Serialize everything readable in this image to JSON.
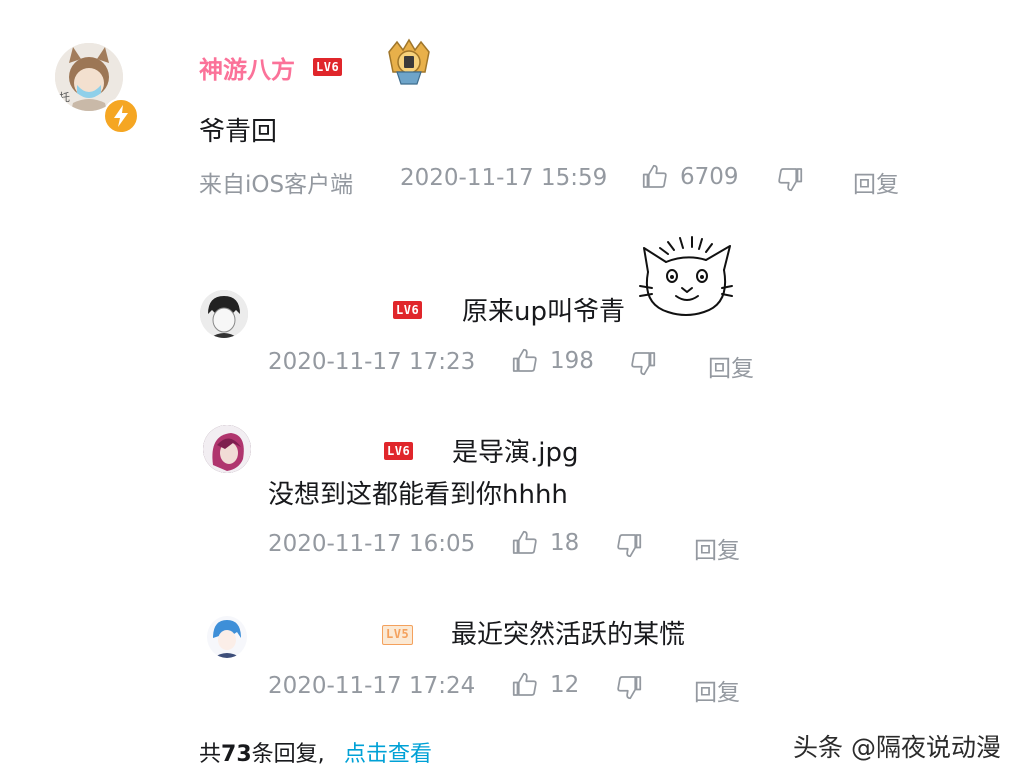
{
  "main_comment": {
    "username": "神游八方",
    "level": "LV6",
    "text": "爷青回",
    "source": "来自iOS客户端",
    "time": "2020-11-17 15:59",
    "likes": "6709",
    "reply_label": "回复",
    "avatar_tag": "托"
  },
  "replies": [
    {
      "level": "LV6",
      "text": "原来up叫爷青",
      "time": "2020-11-17 17:23",
      "likes": "198",
      "reply_label": "回复"
    },
    {
      "level": "LV6",
      "text": "是导演.jpg",
      "text2": "没想到这都能看到你hhhh",
      "time": "2020-11-17 16:05",
      "likes": "18",
      "reply_label": "回复"
    },
    {
      "level": "LV5",
      "text": "最近突然活跃的某慌",
      "time": "2020-11-17 17:24",
      "likes": "12",
      "reply_label": "回复"
    }
  ],
  "footer": {
    "prefix": "共",
    "count": "73",
    "suffix": "条回复,",
    "view_link": "点击查看"
  },
  "watermark": "头条 @隔夜说动漫",
  "colors": {
    "username": "#fb7299",
    "link": "#00a1d6",
    "meta": "#9499a0",
    "level6": "#e0262b"
  }
}
